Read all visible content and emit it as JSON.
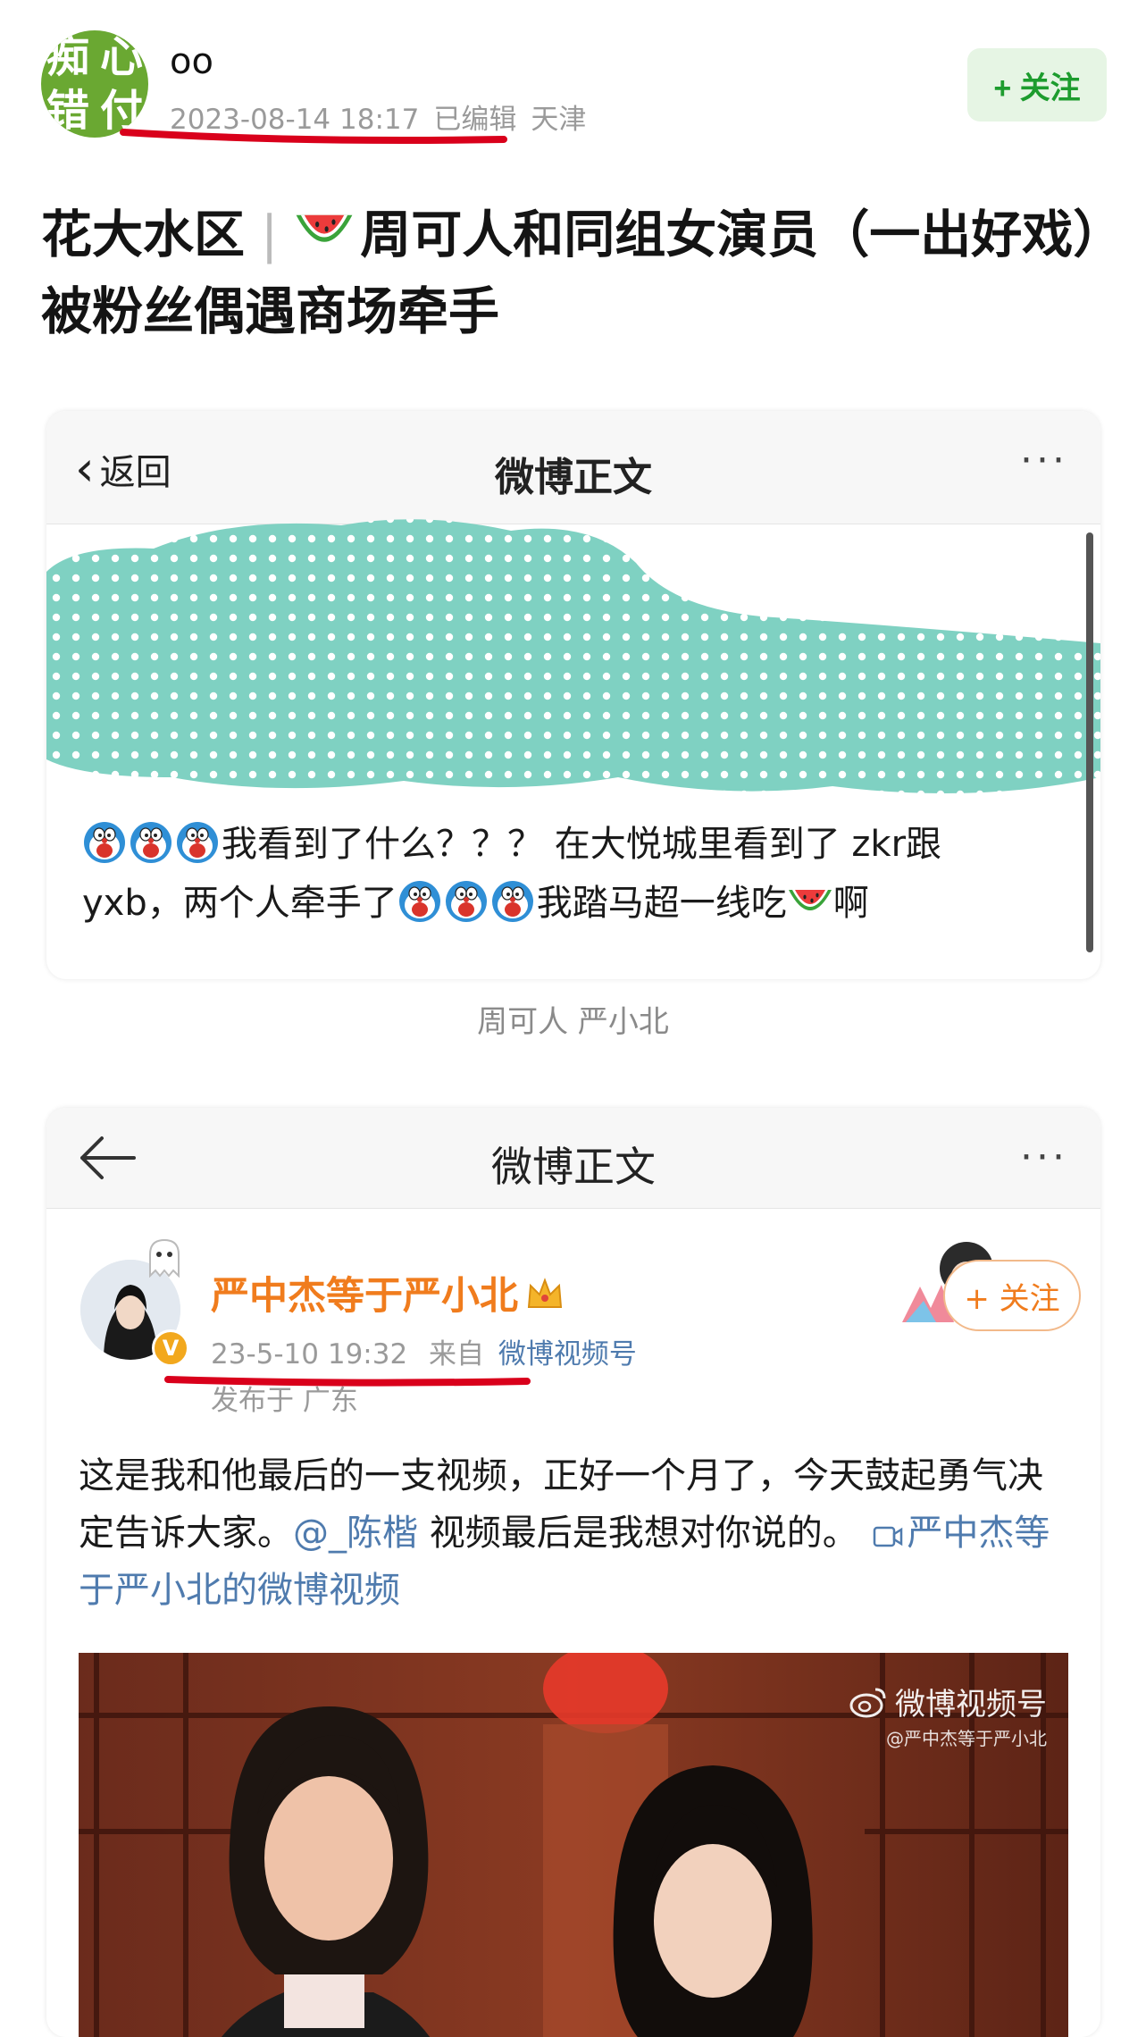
{
  "header": {
    "avatar_chars": [
      "痴",
      "心",
      "错",
      "付"
    ],
    "author_name": "oo",
    "date": "2023-08-14 18:17",
    "edited": "已编辑",
    "location": "天津",
    "follow_label": "+ 关注"
  },
  "post": {
    "title_prefix": "花大水区",
    "title_separator": "|",
    "title_text": "周可人和同组女演员（一出好戏）被粉丝偶遇商场牵手"
  },
  "screenshot1": {
    "back_label": "返回",
    "nav_title": "微博正文",
    "more": "···",
    "text_a": "我看到了什么？？？ 在大悦城里看到了 zkr跟",
    "text_b": "yxb，两个人牵手了",
    "text_c": "我踏马超一线吃",
    "text_d": "啊",
    "caption": "周可人 严小北"
  },
  "screenshot2": {
    "nav_title": "微博正文",
    "more": "···",
    "user_name": "严中杰等于严小北",
    "verified_badge": "V",
    "timestamp": "23-5-10 19:32",
    "source_prefix": "来自",
    "source": "微博视频号",
    "location": "发布于 广东",
    "follow_label": "+ 关注",
    "text_a": "这是我和他最后的一支视频，正好一个月了，今天鼓起勇气决定告诉大家。",
    "mention": "@_陈楷",
    "text_b": " 视频最后是我想对你说的。",
    "video_link": "严中杰等于严小北的微博视频",
    "watermark_main": "微博视频号",
    "watermark_sub": "@严中杰等于严小北"
  },
  "colors": {
    "accent_green": "#1d9c2e",
    "weibo_orange": "#f07c1d",
    "link_blue": "#4f7bae",
    "underline_red": "#d9001b",
    "blur_teal": "#7fd1c2"
  },
  "icons": [
    "chevron-left-icon",
    "more-icon",
    "arrow-left-icon",
    "doraemon-emoji-icon",
    "watermelon-emoji-icon",
    "ghost-icon",
    "crown-icon",
    "video-icon",
    "weibo-logo-icon"
  ]
}
